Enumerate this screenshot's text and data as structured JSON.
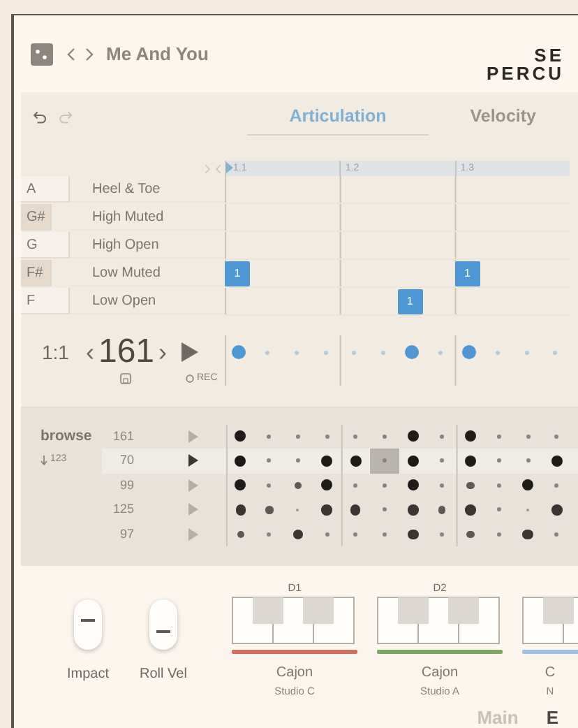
{
  "header": {
    "title": "Me And You",
    "brand": [
      "SE",
      "PERCU"
    ]
  },
  "tabs": [
    {
      "label": "Articulation",
      "selected": true
    },
    {
      "label": "Velocity",
      "selected": false
    }
  ],
  "ruler": [
    "1.1",
    "1.2",
    "1.3"
  ],
  "articulations": [
    {
      "key": "A",
      "black_key": false,
      "name": "Heel & Toe"
    },
    {
      "key": "G#",
      "black_key": true,
      "name": "High Muted"
    },
    {
      "key": "G",
      "black_key": false,
      "name": "High Open"
    },
    {
      "key": "F#",
      "black_key": true,
      "name": "Low Muted",
      "cells": [
        {
          "kind": "note",
          "label": "1"
        },
        {
          "kind": "empty"
        },
        {
          "kind": "empty"
        },
        {
          "kind": "empty"
        },
        {
          "kind": "empty"
        },
        {
          "kind": "empty"
        },
        {
          "kind": "empty"
        },
        {
          "kind": "empty"
        },
        {
          "kind": "note",
          "label": "1"
        }
      ]
    },
    {
      "key": "F",
      "black_key": false,
      "name": "Low Open",
      "cells": [
        {
          "kind": "empty"
        },
        {
          "kind": "empty"
        },
        {
          "kind": "empty"
        },
        {
          "kind": "empty"
        },
        {
          "kind": "empty"
        },
        {
          "kind": "empty"
        },
        {
          "kind": "note",
          "label": "1"
        }
      ]
    }
  ],
  "transport": {
    "position": "1:1",
    "prev": "‹",
    "tempo": "161",
    "next": "›",
    "rec": "REC"
  },
  "step_dots": [
    {
      "on": true
    },
    {
      "on": false
    },
    {
      "on": false
    },
    {
      "on": false
    },
    {
      "on": false
    },
    {
      "on": false
    },
    {
      "on": true
    },
    {
      "on": false
    },
    {
      "on": true
    },
    {
      "on": false
    },
    {
      "on": false
    },
    {
      "on": false
    }
  ],
  "browse": {
    "title": "browse",
    "sort": "123",
    "patterns": [
      {
        "tempo": "161",
        "selected": false,
        "steps": [
          {
            "kind": "accent",
            "selected": false
          },
          {
            "kind": "low",
            "selected": false
          },
          {
            "kind": "low",
            "selected": false
          },
          {
            "kind": "low",
            "selected": false
          },
          {
            "kind": "low",
            "selected": false
          },
          {
            "kind": "low",
            "selected": false
          },
          {
            "kind": "accent",
            "selected": false
          },
          {
            "kind": "low",
            "selected": false
          },
          {
            "kind": "accent",
            "selected": false
          },
          {
            "kind": "low",
            "selected": false
          },
          {
            "kind": "low",
            "selected": false
          },
          {
            "kind": "low",
            "selected": false
          }
        ]
      },
      {
        "tempo": "70",
        "selected": true,
        "steps": [
          {
            "kind": "accent",
            "selected": false
          },
          {
            "kind": "low",
            "selected": false
          },
          {
            "kind": "low",
            "selected": false
          },
          {
            "kind": "accent",
            "selected": false
          },
          {
            "kind": "accent",
            "selected": false
          },
          {
            "kind": "low",
            "selected": true
          },
          {
            "kind": "accent",
            "selected": false
          },
          {
            "kind": "low",
            "selected": false
          },
          {
            "kind": "accent",
            "selected": false
          },
          {
            "kind": "low",
            "selected": false
          },
          {
            "kind": "low",
            "selected": false
          },
          {
            "kind": "accent",
            "selected": false
          }
        ]
      },
      {
        "tempo": "99",
        "selected": false,
        "steps": [
          {
            "kind": "accent",
            "selected": false
          },
          {
            "kind": "low",
            "selected": false
          },
          {
            "kind": "mid",
            "selected": false
          },
          {
            "kind": "accent",
            "selected": false
          },
          {
            "kind": "low",
            "selected": false
          },
          {
            "kind": "low",
            "selected": false
          },
          {
            "kind": "accent",
            "selected": false
          },
          {
            "kind": "low",
            "selected": false
          },
          {
            "kind": "mid",
            "selected": false
          },
          {
            "kind": "low",
            "selected": false
          },
          {
            "kind": "accent",
            "selected": false
          },
          {
            "kind": "low",
            "selected": false
          }
        ]
      },
      {
        "tempo": "125",
        "selected": false,
        "steps": [
          {
            "kind": "high",
            "selected": false
          },
          {
            "kind": "mid",
            "selected": false
          },
          {
            "kind": "ghost",
            "selected": false
          },
          {
            "kind": "high",
            "selected": false
          },
          {
            "kind": "high",
            "selected": false
          },
          {
            "kind": "low",
            "selected": false
          },
          {
            "kind": "high",
            "selected": false
          },
          {
            "kind": "mid",
            "selected": false
          },
          {
            "kind": "high",
            "selected": false
          },
          {
            "kind": "low",
            "selected": false
          },
          {
            "kind": "ghost",
            "selected": false
          },
          {
            "kind": "high",
            "selected": false
          }
        ]
      },
      {
        "tempo": "97",
        "selected": false,
        "steps": [
          {
            "kind": "mid",
            "selected": false
          },
          {
            "kind": "low",
            "selected": false
          },
          {
            "kind": "high",
            "selected": false
          },
          {
            "kind": "low",
            "selected": false
          },
          {
            "kind": "low",
            "selected": false
          },
          {
            "kind": "low",
            "selected": false
          },
          {
            "kind": "high",
            "selected": false
          },
          {
            "kind": "low",
            "selected": false
          },
          {
            "kind": "mid",
            "selected": false
          },
          {
            "kind": "low",
            "selected": false
          },
          {
            "kind": "high",
            "selected": false
          },
          {
            "kind": "low",
            "selected": false
          }
        ]
      }
    ]
  },
  "controls": [
    {
      "label": "Impact",
      "level": 0.6
    },
    {
      "label": "Roll Vel",
      "level": 0.3
    }
  ],
  "instruments": [
    {
      "note": "D1",
      "color": "#cf6f5c",
      "name": "Cajon",
      "room": "Studio C"
    },
    {
      "note": "D2",
      "color": "#7ea862",
      "name": "Cajon",
      "room": "Studio A"
    },
    {
      "color": "#9cc0df",
      "name": "C",
      "room": "N"
    }
  ],
  "footer_tabs": [
    {
      "label": "Main",
      "selected": false
    },
    {
      "label": "E",
      "selected": true
    }
  ]
}
